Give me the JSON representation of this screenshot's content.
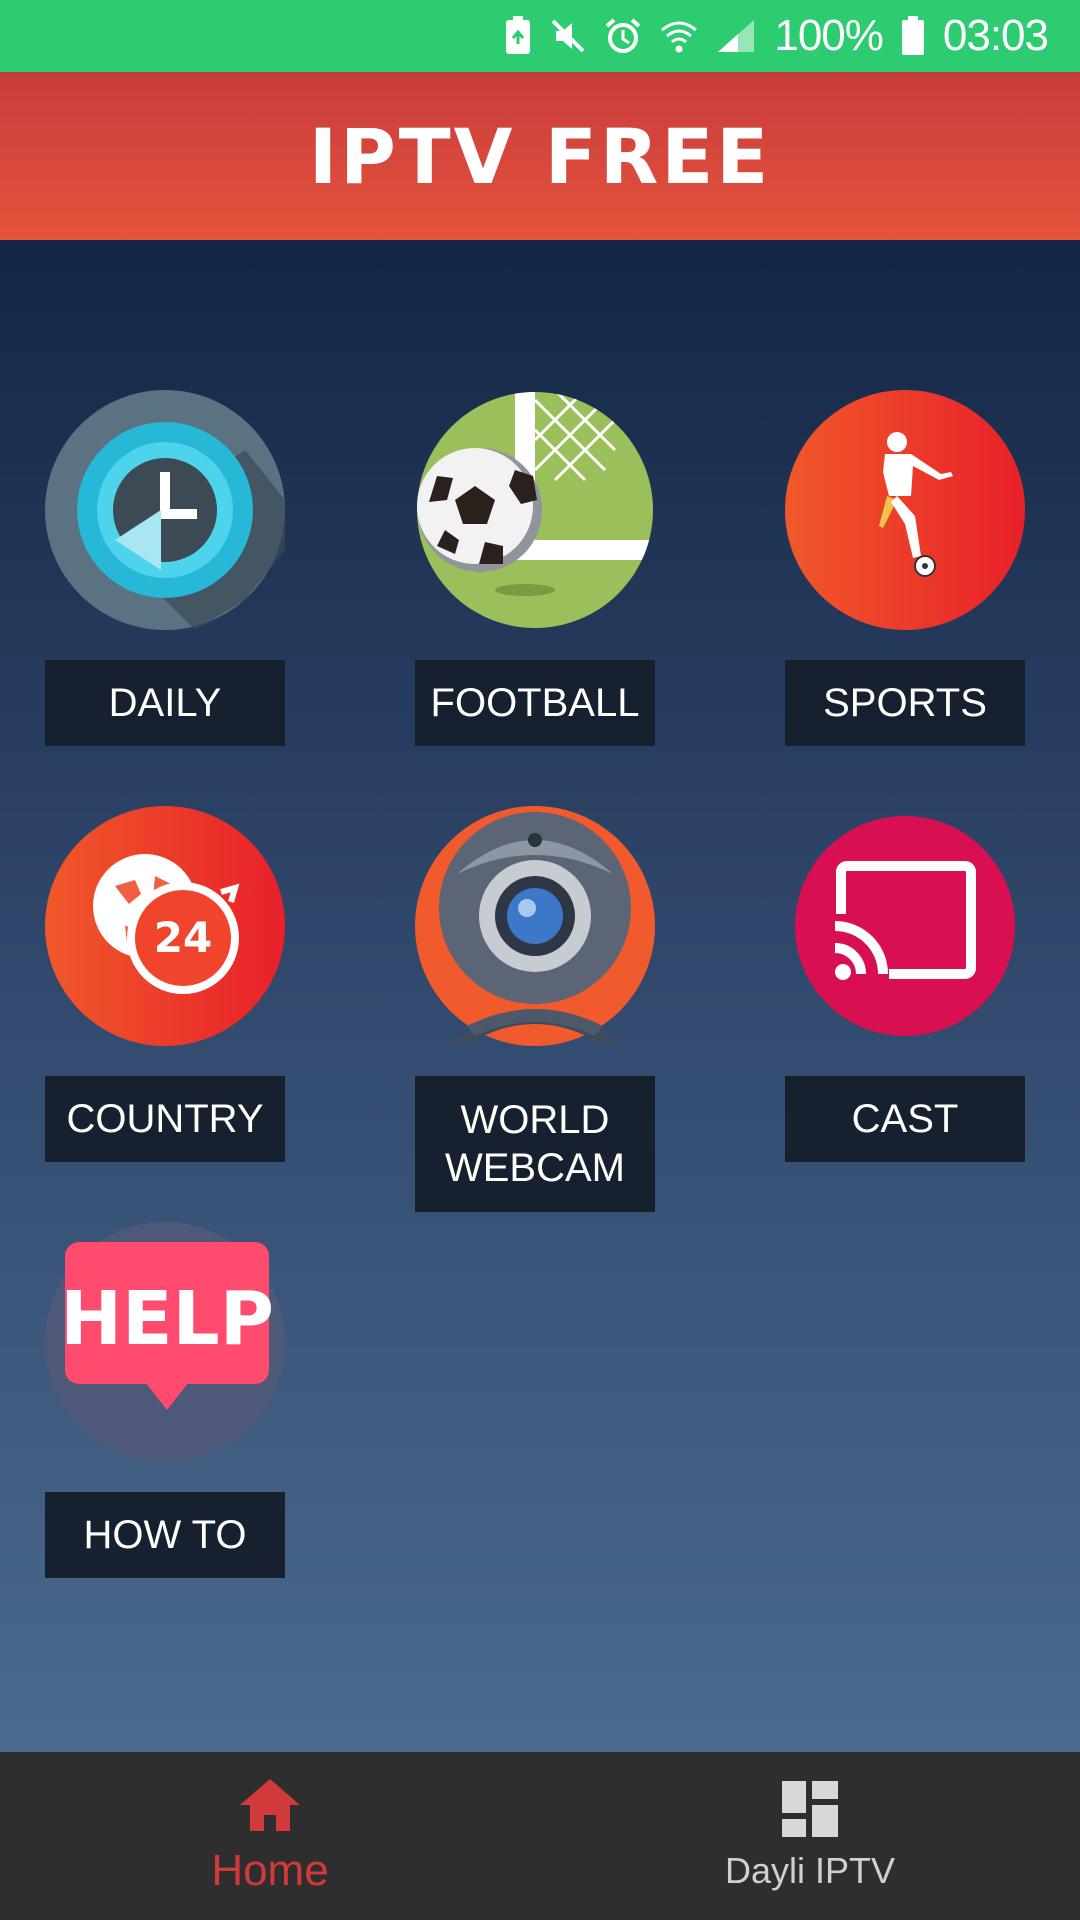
{
  "status_bar": {
    "battery_percent": "100%",
    "time": "03:03",
    "icons": [
      "battery-saver-icon",
      "mute-icon",
      "alarm-icon",
      "wifi-icon",
      "signal-icon",
      "battery-icon"
    ],
    "color": "#2ecc71"
  },
  "header": {
    "title": "IPTV FREE",
    "color": "#d8443c"
  },
  "tiles": [
    {
      "label": "DAILY",
      "icon": "daily-clock-icon"
    },
    {
      "label": "FOOTBALL",
      "icon": "football-goal-icon"
    },
    {
      "label": "SPORTS",
      "icon": "sports-player-icon"
    },
    {
      "label": "COUNTRY",
      "icon": "globe-24-icon"
    },
    {
      "label": "WORLD WEBCAM",
      "icon": "webcam-icon"
    },
    {
      "label": "CAST",
      "icon": "cast-icon"
    },
    {
      "label": "HOW TO",
      "icon": "help-bubble-icon"
    }
  ],
  "bottom_nav": {
    "items": [
      {
        "label": "Home",
        "icon": "home-icon",
        "active": true
      },
      {
        "label": "Dayli IPTV",
        "icon": "dashboard-icon",
        "active": false
      }
    ],
    "active_color": "#d03a3a"
  }
}
